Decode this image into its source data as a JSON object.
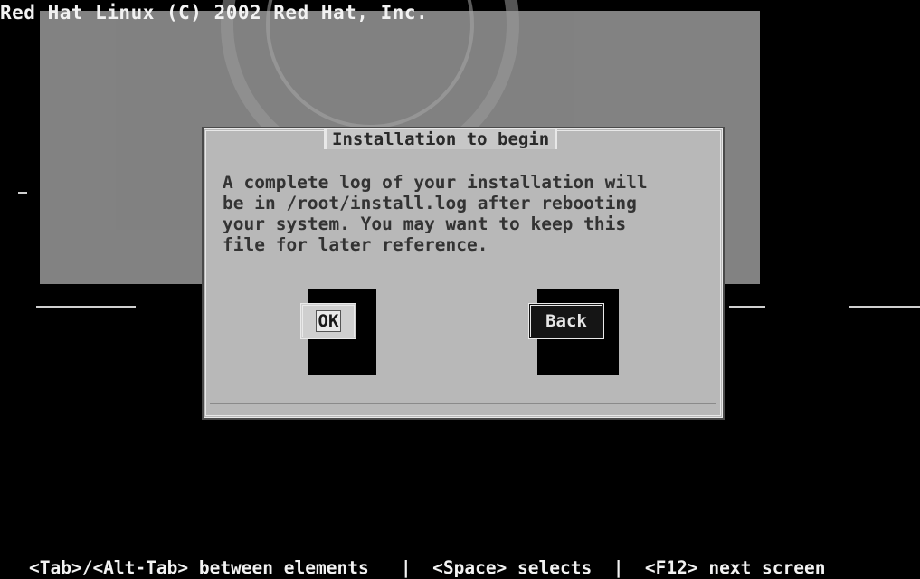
{
  "header": {
    "copyright": "Red Hat Linux (C) 2002 Red Hat, Inc."
  },
  "dialog": {
    "title": "Installation to begin",
    "message_lines": [
      "A complete log of your installation will",
      "be in /root/install.log after rebooting",
      "your system. You may want to keep this",
      "file for later reference."
    ],
    "ok_label": "OK",
    "back_label": "Back"
  },
  "status_bar": {
    "text": "<Tab>/<Alt-Tab> between elements   |  <Space> selects  |  <F12> next screen"
  },
  "colors": {
    "screen_background": "#000000",
    "dialog_background": "#b8b8b8",
    "watermark_overlay": "#8d8d8d"
  }
}
